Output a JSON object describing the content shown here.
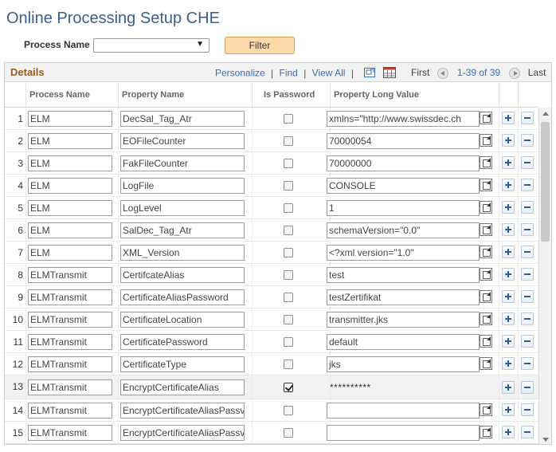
{
  "page": {
    "title": "Online Processing Setup CHE"
  },
  "filter": {
    "label": "Process Name",
    "select_value": "",
    "button_label": "Filter"
  },
  "grid": {
    "caption": "Details",
    "personalize": "Personalize",
    "find": "Find",
    "view_all": "View All",
    "separator": "|",
    "first": "First",
    "range": "1-39 of 39",
    "last": "Last",
    "columns": {
      "process": "Process Name",
      "property": "Property Name",
      "is_password": "Is Password",
      "long_value": "Property Long Value"
    }
  },
  "rows": [
    {
      "num": "1",
      "process": "ELM",
      "property": "DecSal_Tag_Atr",
      "is_password": false,
      "value": "xmlns=\"http://www.swissdec.ch"
    },
    {
      "num": "2",
      "process": "ELM",
      "property": "EOFileCounter",
      "is_password": false,
      "value": "70000054"
    },
    {
      "num": "3",
      "process": "ELM",
      "property": "FakFileCounter",
      "is_password": false,
      "value": "70000000"
    },
    {
      "num": "4",
      "process": "ELM",
      "property": "LogFile",
      "is_password": false,
      "value": "CONSOLE"
    },
    {
      "num": "5",
      "process": "ELM",
      "property": "LogLevel",
      "is_password": false,
      "value": "1"
    },
    {
      "num": "6",
      "process": "ELM",
      "property": "SalDec_Tag_Atr",
      "is_password": false,
      "value": "schemaVersion=\"0.0\""
    },
    {
      "num": "7",
      "process": "ELM",
      "property": "XML_Version",
      "is_password": false,
      "value": "<?xml version=\"1.0\""
    },
    {
      "num": "8",
      "process": "ELMTransmit",
      "property": "CertifcateAlias",
      "is_password": false,
      "value": "test"
    },
    {
      "num": "9",
      "process": "ELMTransmit",
      "property": "CertificateAliasPassword",
      "is_password": false,
      "value": "testZertifikat"
    },
    {
      "num": "10",
      "process": "ELMTransmit",
      "property": "CertificateLocation",
      "is_password": false,
      "value": "transmitter.jks"
    },
    {
      "num": "11",
      "process": "ELMTransmit",
      "property": "CertificatePassword",
      "is_password": false,
      "value": "default"
    },
    {
      "num": "12",
      "process": "ELMTransmit",
      "property": "CertificateType",
      "is_password": false,
      "value": "jks"
    },
    {
      "num": "13",
      "process": "ELMTransmit",
      "property": "EncryptCertificateAlias",
      "is_password": true,
      "value": "**********"
    },
    {
      "num": "14",
      "process": "ELMTransmit",
      "property": "EncryptCertificateAliasPassv",
      "is_password": false,
      "value": ""
    },
    {
      "num": "15",
      "process": "ELMTransmit",
      "property": "EncryptCertificateAliasPassv",
      "is_password": false,
      "value": ""
    }
  ],
  "colors": {
    "title": "#3a5f8f",
    "caption": "#9b5b1b",
    "link": "#3a6db3",
    "filter_button": "#fcd9a8"
  },
  "icons": {
    "expand": "expand-icon",
    "add": "add-row-icon",
    "delete": "delete-row-icon",
    "grid_view": "grid-view-icon",
    "zoom": "zoom-icon"
  }
}
